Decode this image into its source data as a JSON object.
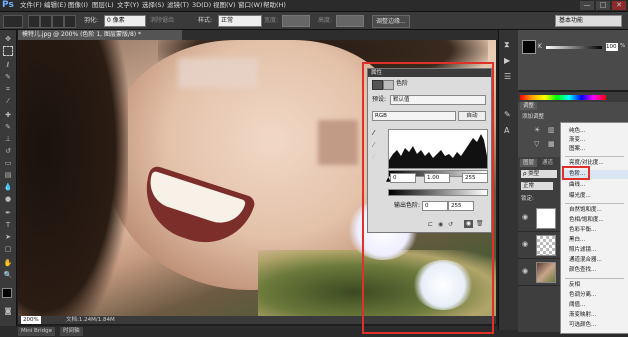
{
  "app": {
    "logo": "Ps"
  },
  "menubar": {
    "items": [
      "文件(F)",
      "编辑(E)",
      "图像(I)",
      "图层(L)",
      "文字(Y)",
      "选择(S)",
      "滤镜(T)",
      "3D(D)",
      "视图(V)",
      "窗口(W)",
      "帮助(H)"
    ],
    "window_buttons": [
      "—",
      "□",
      "✕"
    ]
  },
  "options_bar": {
    "feather_label": "羽化:",
    "feather_value": "0 像素",
    "antialias_label": "消除锯齿",
    "style_label": "样式:",
    "style_value": "正常",
    "width_label": "宽度:",
    "height_label": "高度:",
    "refine_button": "调整边缘...",
    "workspace_value": "基本功能"
  },
  "document": {
    "tab_label": "模特儿.jpg @ 200% (色阶 1, 图层蒙版/8) *",
    "zoom": "200%",
    "doc_info": "文档:1.24M/1.84M"
  },
  "bottom_tabs": [
    "Mini Bridge",
    "时间轴"
  ],
  "levels_panel": {
    "header": "属性",
    "title": "色阶",
    "preset_label": "预设:",
    "preset_value": "默认值",
    "channel_value": "RGB",
    "auto_button": "自动",
    "input_black": "0",
    "input_gamma": "1.00",
    "input_white": "255",
    "output_label": "输出色阶:",
    "output_black": "0",
    "output_white": "255"
  },
  "color_panel": {
    "k_label": "K",
    "k_value": "100",
    "k_unit": "%"
  },
  "adjustments_panel": {
    "tab": "调整",
    "add_label": "添加调整"
  },
  "layers_panel": {
    "tabs": [
      "图层",
      "通道"
    ],
    "kind_value": "ρ 类型",
    "blend_value": "正常",
    "lock_label": "锁定:"
  },
  "adjustment_menu": {
    "items": [
      "纯色...",
      "渐变...",
      "图案...",
      "亮度/对比度...",
      "色阶...",
      "曲线...",
      "曝光度...",
      "自然饱和度...",
      "色相/饱和度...",
      "色彩平衡...",
      "黑白...",
      "照片滤镜...",
      "通道混合器...",
      "颜色查找...",
      "反相",
      "色调分离...",
      "阈值...",
      "渐变映射...",
      "可选颜色..."
    ],
    "highlighted": "色阶..."
  },
  "colors": {
    "highlight_red": "#e0302a",
    "accent_blue": "#6fb0ff"
  }
}
